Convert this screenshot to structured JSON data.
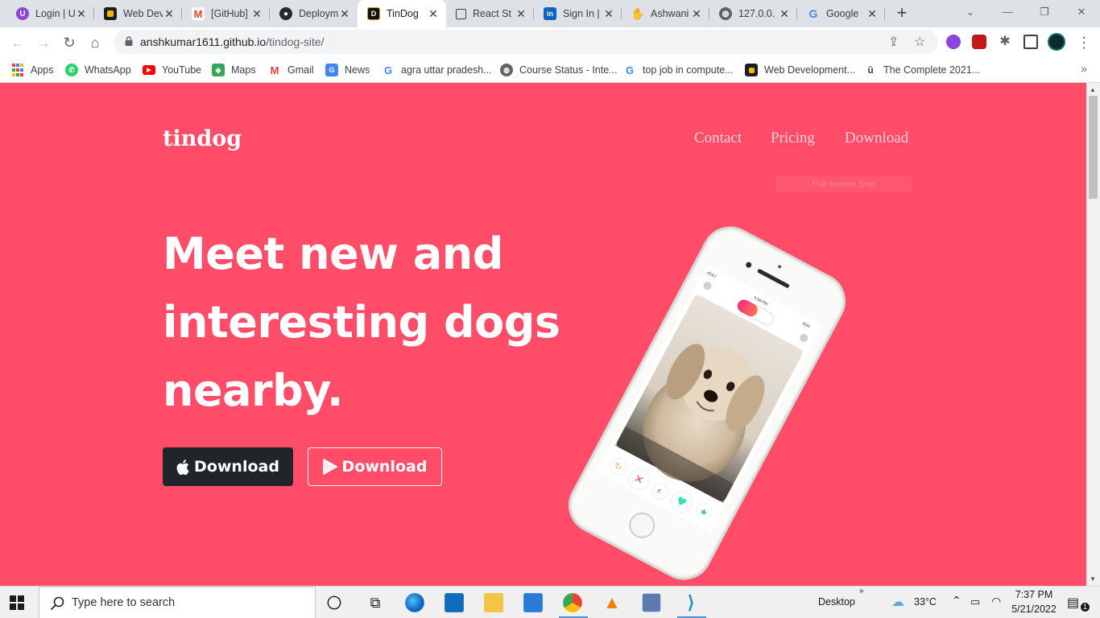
{
  "browser": {
    "tabs": [
      {
        "title": "Login | U",
        "icon": "u-logo-icon",
        "color": "#8e44d8"
      },
      {
        "title": "Web Dev",
        "icon": "udemy-icon",
        "color": "#f4b400"
      },
      {
        "title": "[GitHub]",
        "icon": "gmail-icon",
        "color": "#ea4335"
      },
      {
        "title": "Deploym",
        "icon": "github-icon",
        "color": "#24292e"
      },
      {
        "title": "TinDog",
        "icon": "tindog-icon",
        "color": "#111111",
        "active": true
      },
      {
        "title": "React St",
        "icon": "page-icon",
        "color": "#3c4043"
      },
      {
        "title": "Sign In |",
        "icon": "linkedin-icon",
        "color": "#0a66c2"
      },
      {
        "title": "Ashwani",
        "icon": "wave-hand-icon",
        "color": "#f4b400"
      },
      {
        "title": "127.0.0.",
        "icon": "globe-icon",
        "color": "#5f6368"
      },
      {
        "title": "Google",
        "icon": "google-icon",
        "color": "#4285f4"
      }
    ],
    "url_host": "anshkumar1611.github.io",
    "url_path": "/tindog-site/"
  },
  "bookmarks": [
    {
      "label": "Apps",
      "icon": "apps-grid-icon"
    },
    {
      "label": "WhatsApp",
      "icon": "whatsapp-icon",
      "color": "#25d366"
    },
    {
      "label": "YouTube",
      "icon": "youtube-icon",
      "color": "#ff0000"
    },
    {
      "label": "Maps",
      "icon": "maps-icon",
      "color": "#34a853"
    },
    {
      "label": "Gmail",
      "icon": "gmail-icon",
      "color": "#ea4335"
    },
    {
      "label": "News",
      "icon": "news-icon",
      "color": "#4285f4"
    },
    {
      "label": "agra uttar pradesh...",
      "icon": "google-icon",
      "color": "#4285f4"
    },
    {
      "label": "Course Status - Inte...",
      "icon": "globe-icon",
      "color": "#5f6368"
    },
    {
      "label": "top job in compute...",
      "icon": "google-icon",
      "color": "#4285f4"
    },
    {
      "label": "Web Development...",
      "icon": "udemy-icon",
      "color": "#f4b400"
    },
    {
      "label": "The Complete 2021...",
      "icon": "u-logo-icon",
      "color": "#8e44d8"
    }
  ],
  "site": {
    "brand": "tindog",
    "nav": [
      "Contact",
      "Pricing",
      "Download"
    ],
    "snip_tooltip": "Full-screen Snip",
    "headline": "Meet new and interesting dogs nearby.",
    "buttons": {
      "apple": "Download",
      "google_play": "Download"
    },
    "accent": "#ff4c68",
    "phone_status": {
      "carrier": "AT&T",
      "time": "5:58 PM",
      "battery": "55%"
    }
  },
  "taskbar": {
    "search_placeholder": "Type here to search",
    "desktop_label": "Desktop",
    "weather": "33°C",
    "time": "7:37 PM",
    "date": "5/21/2022",
    "notification_count": "1"
  }
}
